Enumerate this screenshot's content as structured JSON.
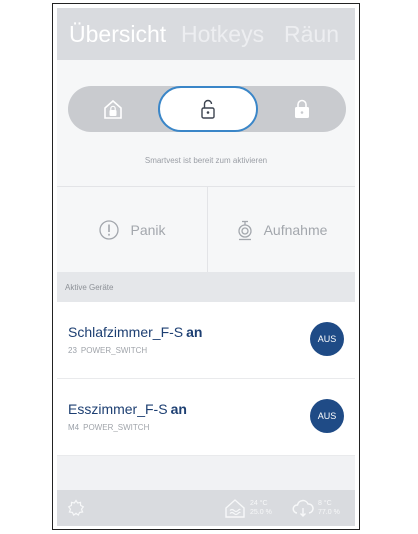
{
  "header": {
    "tabs": [
      {
        "label": "Übersicht"
      },
      {
        "label": "Hotkeys"
      },
      {
        "label": "Räun"
      }
    ]
  },
  "lock": {
    "status_text": "Smartvest ist bereit zum aktivieren",
    "selected": "unlocked"
  },
  "actions": {
    "panic_label": "Panik",
    "record_label": "Aufnahme"
  },
  "section": {
    "active_devices_label": "Aktive Geräte"
  },
  "devices": [
    {
      "name": "Schlafzimmer_F-S",
      "state": "an",
      "code": "23",
      "type": "POWER_SWITCH",
      "button": "AUS"
    },
    {
      "name": "Esszimmer_F-S",
      "state": "an",
      "code": "M4",
      "type": "POWER_SWITCH",
      "button": "AUS"
    }
  ],
  "footer": {
    "home_temp": "24 °C",
    "home_humidity": "25.0 %",
    "outdoor_temp": "8 °C",
    "outdoor_humidity": "77.0 %"
  },
  "colors": {
    "accent_blue": "#1f4b86",
    "selection_border": "#3a86c8"
  }
}
